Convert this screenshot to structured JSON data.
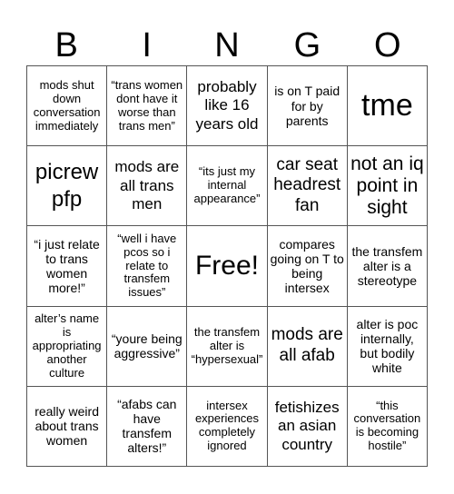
{
  "header": [
    "B",
    "I",
    "N",
    "G",
    "O"
  ],
  "cells": [
    "mods shut down conversation immediately",
    "“trans women dont have it worse than trans men”",
    "probably like 16 years old",
    "is on T paid for by parents",
    "tme",
    "picrew pfp",
    "mods are all trans men",
    "“its just my internal appearance”",
    "car seat headrest fan",
    "not an iq point in sight",
    "“i just relate to trans women more!”",
    "“well i have pcos so i relate to transfem issues”",
    "Free!",
    "compares going on T to being intersex",
    "the transfem alter is a stereotype",
    "alter’s name is appropriating another culture",
    "“youre being aggressive”",
    "the transfem alter is “hypersexual”",
    "mods are all afab",
    "alter is poc internally, but bodily white",
    "really weird about trans women",
    "“afabs can have transfem alters!”",
    "intersex experiences completely ignored",
    "fetishizes an asian country",
    "“this conversation is becoming hostile”"
  ]
}
